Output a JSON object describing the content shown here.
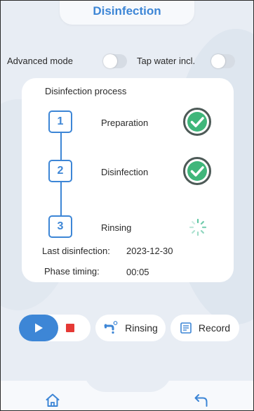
{
  "header": {
    "title": "Disinfection"
  },
  "toggles": {
    "advanced_mode": {
      "label": "Advanced mode",
      "on": false
    },
    "tap_water": {
      "label": "Tap water incl.",
      "on": false
    }
  },
  "process": {
    "title": "Disinfection process",
    "steps": [
      {
        "number": "1",
        "label": "Preparation",
        "status": "done",
        "icon": "check-circle-icon"
      },
      {
        "number": "2",
        "label": "Disinfection",
        "status": "done",
        "icon": "check-circle-icon"
      },
      {
        "number": "3",
        "label": "Rinsing",
        "status": "in-progress",
        "icon": "spinner-icon"
      }
    ],
    "last_disinfection_label": "Last disinfection:",
    "last_disinfection_value": "2023-12-30",
    "phase_timing_label": "Phase timing:",
    "phase_timing_value": "00:05"
  },
  "controls": {
    "play_icon": "play-icon",
    "stop_icon": "stop-icon",
    "rinsing_label": "Rinsing",
    "record_label": "Record"
  },
  "nav": {
    "home_icon": "home-icon",
    "back_icon": "back-arrow-icon"
  },
  "colors": {
    "accent": "#3d86d6",
    "success": "#3fb67a",
    "stop": "#e53935",
    "background": "#e8edf4"
  }
}
